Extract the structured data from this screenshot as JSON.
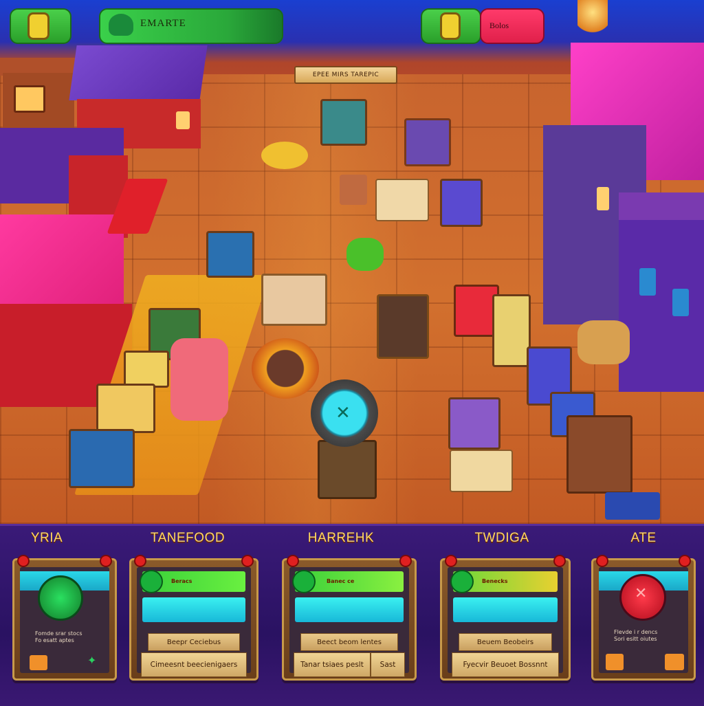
{
  "hud": {
    "left_pill_icon": "coin-icon",
    "title_pill_label": "EMARTE",
    "right_green_icon": "coin-icon",
    "right_red_label": "Bolos"
  },
  "map": {
    "banner_label": "EPEE MIRS TAREPIC"
  },
  "panel": {
    "columns": [
      {
        "title": "YRIA",
        "orb_color": "#2ad060",
        "text1": "Fomde srar stocs",
        "text2": "Fo esatt aptes"
      },
      {
        "title": "TANEFOOD",
        "badge": "Beracs",
        "label1": "Beepr Ceciebus",
        "label2": "Cimeesnt beecienigaers"
      },
      {
        "title": "HARREHK",
        "badge": "Banec ce",
        "label1": "Beect beom lentes",
        "label2": "Tanar tsiaes peslt",
        "label2b": "Sast"
      },
      {
        "title": "TWDIGA",
        "badge": "Benecks",
        "label1": "Beuem Beobeirs",
        "label2": "Fyecvir Beuoet Bossnnt"
      },
      {
        "title": "ATE",
        "orb_color": "#e8202c",
        "text1": "Flevde i r dencs",
        "text2": "Sori esitt oiutes"
      }
    ]
  },
  "colors": {
    "accent_green": "#2ac848",
    "accent_red": "#e8204a",
    "panel_bg": "#2a1262",
    "title_gold": "#ffd860"
  }
}
